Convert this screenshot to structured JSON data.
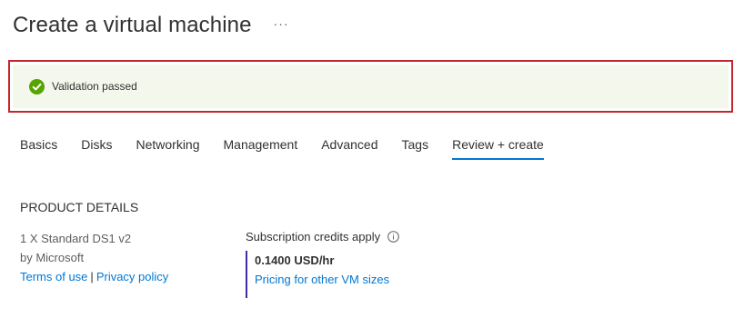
{
  "header": {
    "title": "Create a virtual machine",
    "more_label": "···"
  },
  "validation": {
    "text": "Validation passed",
    "icon": "check-circle-icon",
    "status_color": "#57a300",
    "outline_color": "#c4262e"
  },
  "tabs": [
    {
      "label": "Basics",
      "active": false
    },
    {
      "label": "Disks",
      "active": false
    },
    {
      "label": "Networking",
      "active": false
    },
    {
      "label": "Management",
      "active": false
    },
    {
      "label": "Advanced",
      "active": false
    },
    {
      "label": "Tags",
      "active": false
    },
    {
      "label": "Review + create",
      "active": true
    }
  ],
  "product_details": {
    "heading": "PRODUCT DETAILS",
    "name": "1 X Standard DS1 v2",
    "vendor": "by Microsoft",
    "terms_label": "Terms of use",
    "separator": "|",
    "privacy_label": "Privacy policy"
  },
  "pricing": {
    "credits_text": "Subscription credits apply",
    "info_icon": "info-icon",
    "price": "0.1400 USD/hr",
    "other_sizes_link": "Pricing for other VM sizes"
  },
  "colors": {
    "accent": "#0078d4",
    "banner_bg": "#f4f8ec",
    "price_bar": "#3b2ea0"
  }
}
